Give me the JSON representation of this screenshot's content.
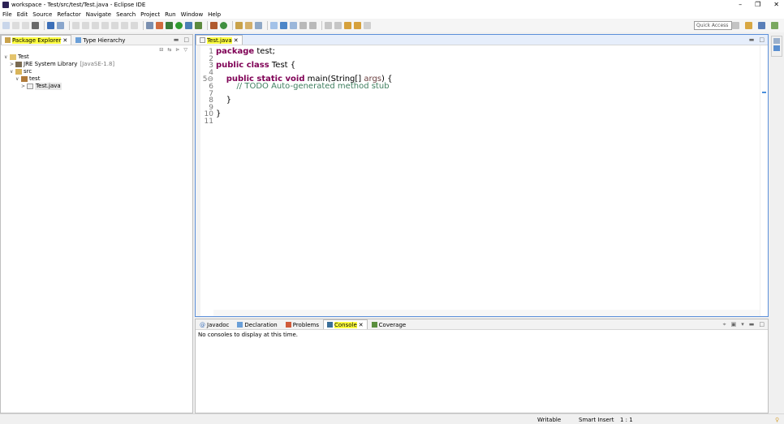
{
  "window": {
    "title": "workspace - Test/src/test/Test.java - Eclipse IDE",
    "controls": [
      "–",
      "❐",
      "✕"
    ]
  },
  "menu": [
    "File",
    "Edit",
    "Source",
    "Refactor",
    "Navigate",
    "Search",
    "Project",
    "Run",
    "Window",
    "Help"
  ],
  "toolbar": {
    "quick_access_placeholder": "Quick Access"
  },
  "left_panel": {
    "tabs": [
      {
        "label": "Package Explorer",
        "close": "✕"
      },
      {
        "label": "Type Hierarchy"
      }
    ],
    "tree": [
      {
        "label": "Test",
        "toggle": "∨",
        "level": 0
      },
      {
        "label": "JRE System Library",
        "extra": "[JavaSE-1.8]",
        "toggle": ">",
        "level": 1
      },
      {
        "label": "src",
        "toggle": "∨",
        "level": 1
      },
      {
        "label": "test",
        "toggle": "∨",
        "level": 2
      },
      {
        "label": "Test.java",
        "toggle": ">",
        "level": 3
      }
    ]
  },
  "editor": {
    "tab_label": "Test.java",
    "tab_close": "✕",
    "line_numbers": [
      "1",
      "2",
      "3",
      "4",
      "5⊖",
      "6",
      "7",
      "8",
      "9",
      "10",
      "11"
    ],
    "code": {
      "l1_kw": "package",
      "l1_rest": " test;",
      "l3_kw": "public class",
      "l3_rest": " Test {",
      "l5_kw": "public static void",
      "l5_rest1": " main(String[] ",
      "l5_param": "args",
      "l5_rest2": ") {",
      "l6_comment": "// TODO Auto-generated method stub",
      "l8": "}",
      "l10": "}"
    }
  },
  "bottom_panel": {
    "tabs": [
      {
        "label": "Javadoc"
      },
      {
        "label": "Declaration"
      },
      {
        "label": "Problems"
      },
      {
        "label": "Console",
        "close": "✕"
      },
      {
        "label": "Coverage"
      }
    ],
    "empty_message": "No consoles to display at this time."
  },
  "status": {
    "writable": "Writable",
    "insert_mode": "Smart Insert",
    "position": "1 : 1"
  },
  "colors": {
    "keyword": "#7f0055",
    "comment": "#3f7f5f",
    "highlight": "#ffff40"
  }
}
